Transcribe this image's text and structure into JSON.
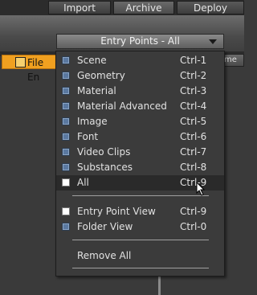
{
  "tabs": [
    {
      "label": "Import"
    },
    {
      "label": "Archive"
    },
    {
      "label": "Deploy"
    }
  ],
  "entry_points_dropdown": {
    "label": "Entry Points - All"
  },
  "left_panel": {
    "file_entry_label": "File En",
    "column_header": "me"
  },
  "menu": {
    "items": [
      {
        "label": "Scene",
        "shortcut": "Ctrl-1",
        "checked": false
      },
      {
        "label": "Geometry",
        "shortcut": "Ctrl-2",
        "checked": false
      },
      {
        "label": "Material",
        "shortcut": "Ctrl-3",
        "checked": false
      },
      {
        "label": "Material Advanced",
        "shortcut": "Ctrl-4",
        "checked": false
      },
      {
        "label": "Image",
        "shortcut": "Ctrl-5",
        "checked": false
      },
      {
        "label": "Font",
        "shortcut": "Ctrl-6",
        "checked": false
      },
      {
        "label": "Video Clips",
        "shortcut": "Ctrl-7",
        "checked": false
      },
      {
        "label": "Substances",
        "shortcut": "Ctrl-8",
        "checked": false
      },
      {
        "label": "All",
        "shortcut": "Ctrl-9",
        "checked": true
      }
    ],
    "view_items": [
      {
        "label": "Entry Point View",
        "shortcut": "Ctrl-9",
        "checked": true
      },
      {
        "label": "Folder View",
        "shortcut": "Ctrl-0",
        "checked": false
      }
    ],
    "remove_all_label": "Remove All"
  },
  "colors": {
    "accent": "#f0a020",
    "checkbox": "#8aa4c4"
  }
}
